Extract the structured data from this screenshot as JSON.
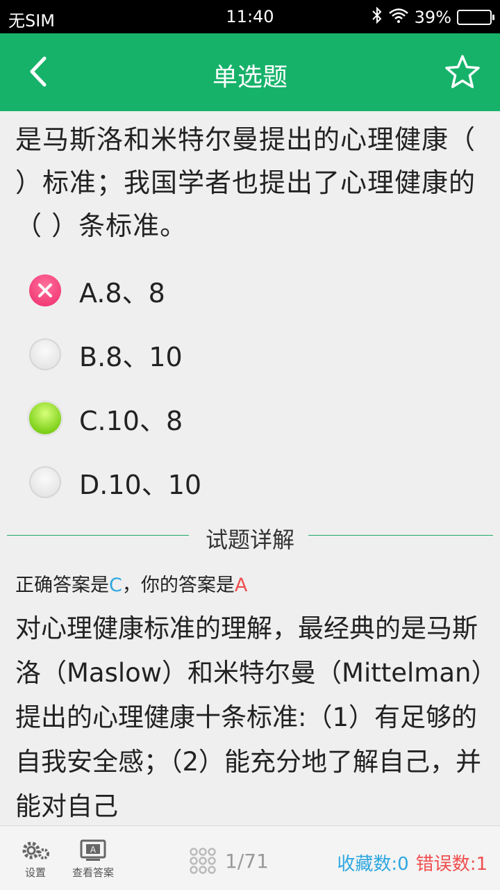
{
  "status": {
    "carrier": "无SIM",
    "time": "11:40",
    "battery": "39%"
  },
  "nav": {
    "title": "单选题",
    "back_icon": "chevron-left-icon",
    "favorite_icon": "star-outline-icon"
  },
  "question": {
    "text": "是马斯洛和米特尔曼提出的心理健康（ ）标准；我国学者也提出了心理健康的（ ）条标准。"
  },
  "options": [
    {
      "label": "A.8、8",
      "state": "wrong"
    },
    {
      "label": "B.8、10",
      "state": "unselected"
    },
    {
      "label": "C.10、8",
      "state": "correct"
    },
    {
      "label": "D.10、10",
      "state": "unselected"
    }
  ],
  "detail": {
    "heading": "试题详解",
    "answer_prefix": "正确答案是",
    "correct": "C",
    "your_prefix": "，你的答案是",
    "yours": "A",
    "explanation": "对心理健康标准的理解，最经典的是马斯洛（Maslow）和米特尔曼（Mittelman）提出的心理健康十条标准:（1）有足够的自我安全感；（2）能充分地了解自己，并能对自己"
  },
  "bottom": {
    "settings_label": "设置",
    "view_answer_label": "查看答案",
    "page_indicator": "1/71",
    "favorites": "收藏数:0",
    "errors": "错误数:1"
  },
  "colors": {
    "accent": "#17b26a",
    "correct_text": "#2ea7e0",
    "wrong_text": "#ef4f4f"
  }
}
